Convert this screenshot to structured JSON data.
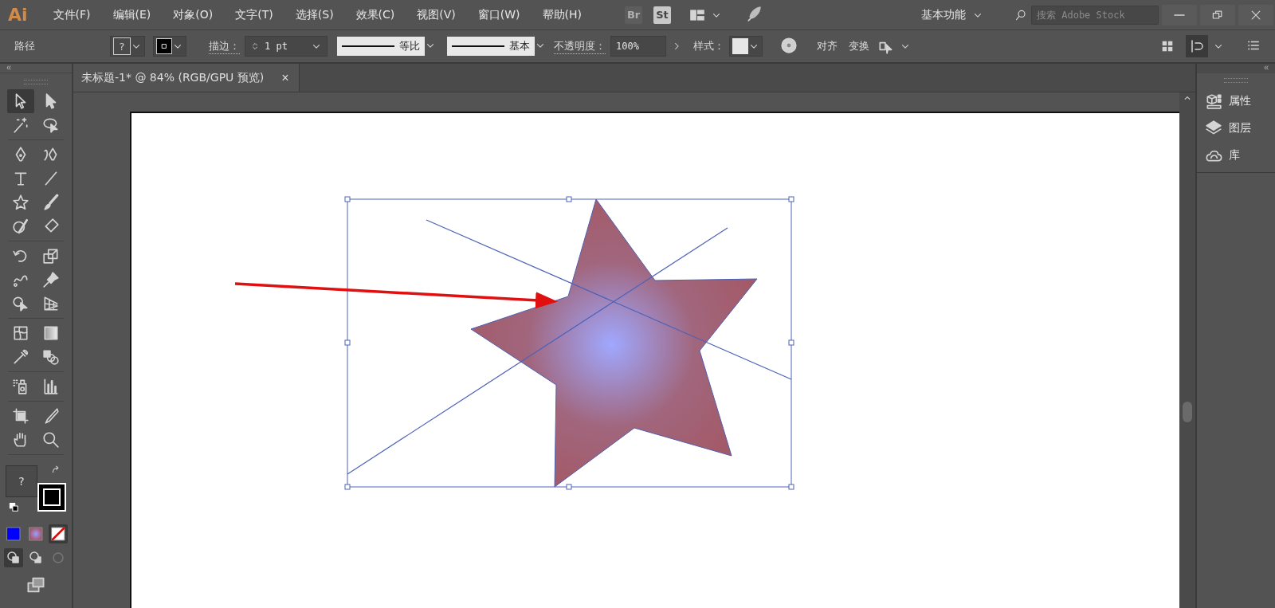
{
  "menu_bar": {
    "logo": "Ai",
    "items": [
      "文件(F)",
      "编辑(E)",
      "对象(O)",
      "文字(T)",
      "选择(S)",
      "效果(C)",
      "视图(V)",
      "窗口(W)",
      "帮助(H)"
    ],
    "bridge": "Br",
    "stock": "St",
    "workspace": "基本功能",
    "search": {
      "placeholder": "搜索 Adobe Stock"
    }
  },
  "control_bar": {
    "object_type": "路径",
    "fill_value": "?",
    "stroke_label": "描边：",
    "stroke_weight": "1 pt",
    "profile": "等比",
    "brush": "基本",
    "opacity_label": "不透明度：",
    "opacity": "100%",
    "style_label": "样式：",
    "align": "对齐",
    "transform": "变换"
  },
  "toolbar": {
    "tools": [
      {
        "selected": true
      },
      {
        "selected": false
      },
      {
        "selected": false
      },
      {
        "selected": false
      },
      {
        "selected": false
      },
      {
        "selected": false
      },
      {
        "selected": false
      },
      {
        "selected": false
      },
      {
        "selected": false
      },
      {
        "selected": false
      },
      {
        "selected": false
      },
      {
        "selected": false
      },
      {
        "selected": false
      },
      {
        "selected": false
      },
      {
        "selected": false
      },
      {
        "selected": false
      },
      {
        "selected": false
      },
      {
        "selected": false
      },
      {
        "selected": false
      },
      {
        "selected": false
      },
      {
        "selected": false
      },
      {
        "selected": false
      },
      {
        "selected": false
      },
      {
        "selected": false
      },
      {
        "selected": false
      },
      {
        "selected": false
      },
      {
        "selected": false
      },
      {
        "selected": false
      }
    ],
    "fill_value": "?",
    "color_modes": [
      {
        "selected": false
      },
      {
        "selected": false
      },
      {
        "selected": true
      }
    ],
    "draw_modes": [
      {
        "selected": true
      },
      {
        "selected": false
      },
      {
        "selected": false
      }
    ]
  },
  "document_tab": {
    "title": "未标题-1* @ 84% (RGB/GPU 预览)",
    "close": "×"
  },
  "right_panel": {
    "items": [
      "属性",
      "图层",
      "库"
    ]
  }
}
